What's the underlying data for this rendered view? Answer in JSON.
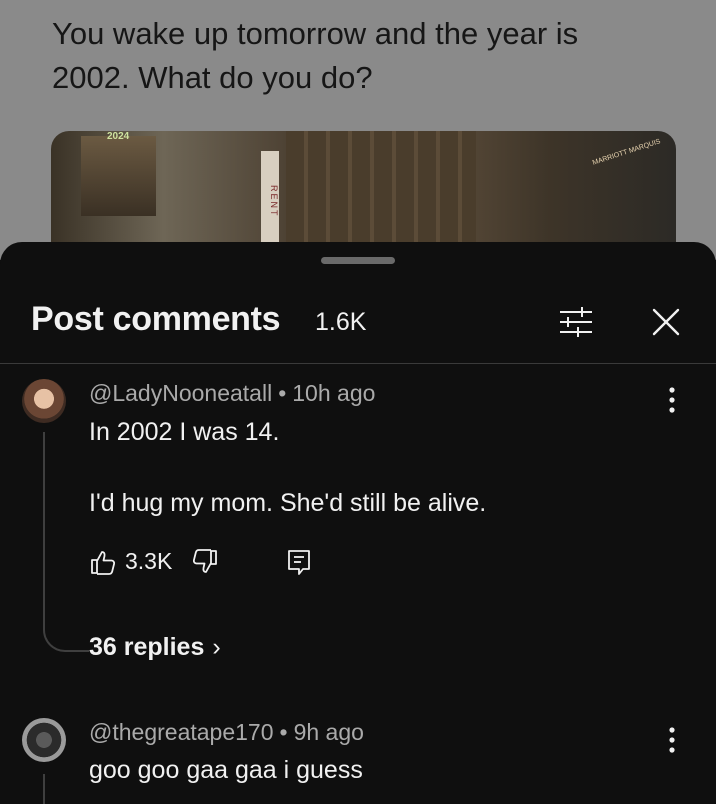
{
  "post": {
    "title_line1": "You wake up tomorrow and the year is",
    "title_line2": "2002. What do you do?",
    "image_sign_year": "2024",
    "image_vertical_sign": "RENT",
    "image_marriott": "MARRIOTT MARQUIS"
  },
  "sheet": {
    "title": "Post comments",
    "count": "1.6K",
    "filter_icon": "filter-sliders-icon",
    "close_icon": "close-icon"
  },
  "comments": [
    {
      "author": "@LadyNooneatall",
      "time": "10h ago",
      "line1": "In 2002 I was 14.",
      "line2": "I'd hug my mom. She'd still be alive.",
      "likes": "3.3K",
      "replies": "36 replies"
    },
    {
      "author": "@thegreatape170",
      "time": "9h ago",
      "line1": "goo goo gaa gaa i guess"
    }
  ],
  "colors": {
    "background": "#0f0f0f",
    "text": "#f1f1f1",
    "secondary_text": "#aaaaaa",
    "divider": "#3a3a3a"
  }
}
